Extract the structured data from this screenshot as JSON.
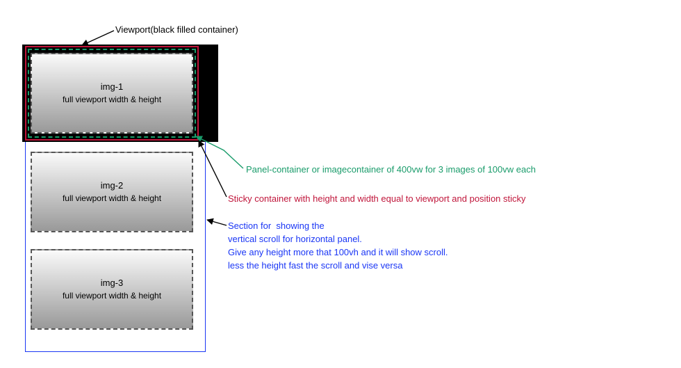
{
  "labels": {
    "viewport": "Viewport(black filled container)",
    "panel": "Panel-container or imagecontainer of 400vw for 3 images of 100vw each",
    "sticky": "Sticky container with height and width equal to viewport and position sticky",
    "section": "Section for  showing the\nvertical scroll for horizontal panel.\nGive any height more that 100vh and it will show scroll.\nless the height fast the scroll and vise versa"
  },
  "panels": {
    "img1": {
      "title": "img-1",
      "sub": "full viewport width & height"
    },
    "img2": {
      "title": "img-2",
      "sub": "full viewport width & height"
    },
    "img3": {
      "title": "img-3",
      "sub": "full viewport width & height"
    }
  },
  "colors": {
    "viewport_fill": "#000000",
    "sticky_border": "#c0153a",
    "panel_border": "#1a9c6b",
    "section_border": "#1a36f5"
  },
  "chart_data": {
    "type": "diagram",
    "description": "Nested-container layout explaining a vertical-scroll-drives-horizontal-panel technique",
    "containers": [
      {
        "name": "Viewport",
        "style": "black filled",
        "role": "browser viewport"
      },
      {
        "name": "Sticky container",
        "style": "red solid border",
        "role": "position:sticky; size = viewport"
      },
      {
        "name": "Panel-container",
        "style": "green dashed border",
        "role": "width 400vw holding 3 images of 100vw each"
      },
      {
        "name": "Section",
        "style": "blue solid border",
        "role": "tall section; height > 100vh produces scroll; less height = faster scroll and vice versa"
      }
    ],
    "images": [
      {
        "id": "img-1",
        "note": "full viewport width & height"
      },
      {
        "id": "img-2",
        "note": "full viewport width & height"
      },
      {
        "id": "img-3",
        "note": "full viewport width & height"
      }
    ]
  }
}
